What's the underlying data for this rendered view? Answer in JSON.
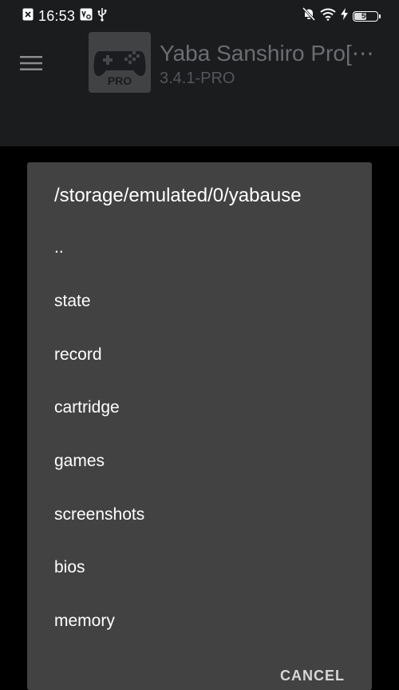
{
  "status_bar": {
    "time": "16:53",
    "battery_level": "50",
    "battery_fraction": 0.5,
    "left_icons": [
      "close-notification-icon",
      "vo-lte-icon",
      "usb-icon"
    ],
    "right_icons": [
      "bell-off-icon",
      "wifi-icon",
      "charging-bolt-icon",
      "battery-icon"
    ]
  },
  "app_bar": {
    "menu_icon": "hamburger-menu-icon",
    "app_title": "Yaba Sanshiro Pro[⋯",
    "app_version": "3.4.1-PRO",
    "app_icon_badge": "PRO"
  },
  "dialog": {
    "title": "/storage/emulated/0/yabause",
    "items": [
      {
        "label": ".."
      },
      {
        "label": "state"
      },
      {
        "label": "record"
      },
      {
        "label": "cartridge"
      },
      {
        "label": "games"
      },
      {
        "label": "screenshots"
      },
      {
        "label": "bios"
      },
      {
        "label": "memory"
      }
    ],
    "action_label": "CANCEL"
  },
  "colors": {
    "background": "#000000",
    "bar_background": "#1a1c1e",
    "dialog_background": "#424242",
    "text_primary": "#ffffff",
    "text_dimmed": "#6b6d70"
  }
}
